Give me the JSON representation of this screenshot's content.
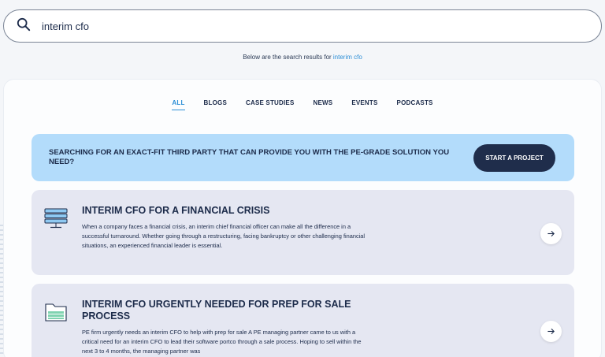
{
  "search": {
    "value": "interim cfo",
    "icon": "search-icon"
  },
  "results_note": {
    "prefix": "Below are the search results for ",
    "query": "interim cfo"
  },
  "tabs": [
    {
      "label": "ALL",
      "active": true
    },
    {
      "label": "BLOGS",
      "active": false
    },
    {
      "label": "CASE STUDIES",
      "active": false
    },
    {
      "label": "NEWS",
      "active": false
    },
    {
      "label": "EVENTS",
      "active": false
    },
    {
      "label": "PODCASTS",
      "active": false
    }
  ],
  "cta": {
    "text": "SEARCHING FOR AN EXACT-FIT THIRD PARTY THAT CAN PROVIDE YOU WITH THE PE-GRADE SOLUTION YOU NEED?",
    "button": "START A PROJECT"
  },
  "results": [
    {
      "icon": "server-stack-icon",
      "title": "INTERIM CFO FOR A FINANCIAL CRISIS",
      "description": "When a company faces a financial crisis, an interim chief financial officer can make all the difference in a successful turnaround. Whether going through a restructuring, facing bankruptcy or other challenging financial situations, an experienced financial leader is essential."
    },
    {
      "icon": "folder-icon",
      "title": "INTERIM CFO URGENTLY NEEDED FOR PREP FOR SALE PROCESS",
      "description": "PE firm urgently needs an interim CFO to help with prep for sale A PE managing partner came to us with a critical need for an interim CFO to lead their software portco through a sale process. Hoping to sell within the next 3 to 4 months, the managing partner was"
    }
  ],
  "colors": {
    "accent": "#2e8fd6",
    "dark": "#1f2d4b",
    "cta_bg": "#b3dcfb",
    "card_bg": "#e5e7f2"
  }
}
